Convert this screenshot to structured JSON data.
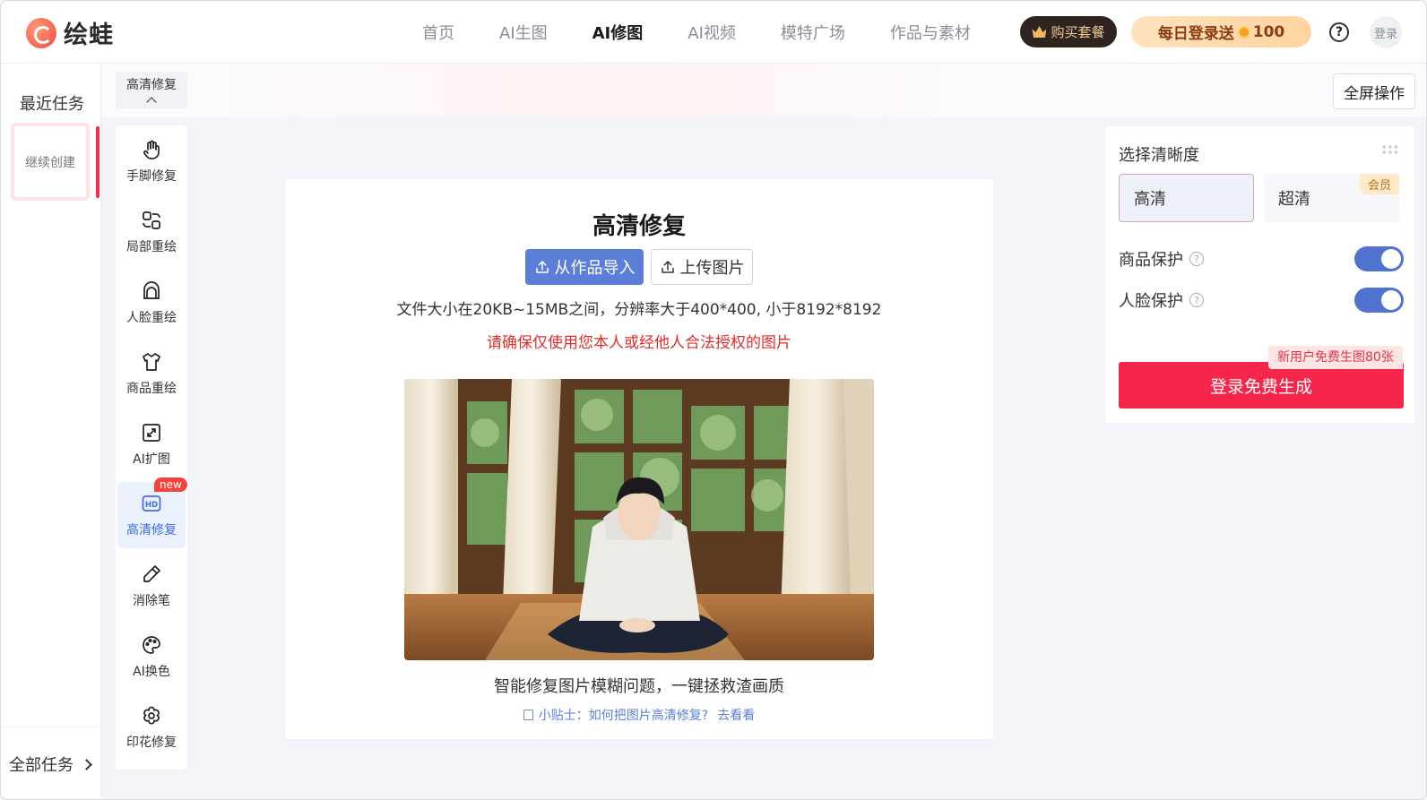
{
  "app": {
    "logo_text": "绘蛙"
  },
  "nav": {
    "items": [
      "首页",
      "AI生图",
      "AI修图",
      "AI视频",
      "模特广场",
      "作品与素材"
    ],
    "active_index": 2
  },
  "header": {
    "buy_label": "购买套餐",
    "daily_label": "每日登录送",
    "daily_amount": "100",
    "help_icon": "?",
    "login_label": "登录"
  },
  "tasks": {
    "title": "最近任务",
    "continue_label": "继续创建",
    "all_label": "全部任务"
  },
  "tool_header": {
    "label": "高清修复"
  },
  "tools": [
    {
      "label": "手脚修复",
      "icon": "hand-icon"
    },
    {
      "label": "局部重绘",
      "icon": "partial-repaint-icon"
    },
    {
      "label": "人脸重绘",
      "icon": "face-icon"
    },
    {
      "label": "商品重绘",
      "icon": "shirt-icon"
    },
    {
      "label": "AI扩图",
      "icon": "expand-icon"
    },
    {
      "label": "高清修复",
      "icon": "hd-icon",
      "badge": "new",
      "active": true
    },
    {
      "label": "消除笔",
      "icon": "eraser-pen-icon"
    },
    {
      "label": "AI换色",
      "icon": "palette-icon"
    },
    {
      "label": "印花修复",
      "icon": "flower-icon"
    }
  ],
  "toolbar": {
    "fullscreen_label": "全屏操作"
  },
  "upload": {
    "title": "高清修复",
    "import_label": "从作品导入",
    "upload_label": "上传图片",
    "size_note": "文件大小在20KB~15MB之间，分辨率大于400*400, 小于8192*8192",
    "legal_note": "请确保仅使用您本人或经他人合法授权的图片",
    "caption": "智能修复图片模糊问题，一键拯救渣画质",
    "tip_text": "小贴士：如何把图片高清修复?",
    "tip_link": "去看看"
  },
  "settings": {
    "title": "选择清晰度",
    "options": [
      {
        "label": "高清",
        "selected": true
      },
      {
        "label": "超清",
        "badge": "会员"
      }
    ],
    "toggles": [
      {
        "label": "商品保护",
        "on": true
      },
      {
        "label": "人脸保护",
        "on": true
      }
    ],
    "promo": "新用户免费生图80张",
    "generate_label": "登录免费生成"
  },
  "colors": {
    "accent_blue": "#5b7fd6",
    "primary_red": "#f5264a",
    "warning_red": "#e12b2b"
  }
}
